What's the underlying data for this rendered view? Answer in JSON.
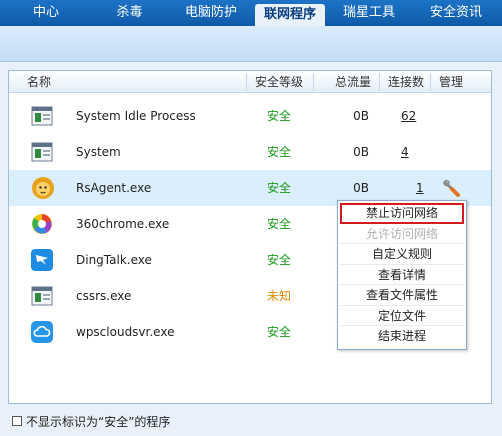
{
  "nav": {
    "tabs": [
      {
        "label": "中心"
      },
      {
        "label": "杀毒"
      },
      {
        "label": "电脑防护"
      },
      {
        "label": "联网程序"
      },
      {
        "label": "瑞星工具"
      },
      {
        "label": "安全资讯"
      }
    ],
    "active_index": 3
  },
  "table": {
    "headers": {
      "name": "名称",
      "level": "安全等级",
      "traffic": "总流量",
      "connections": "连接数",
      "manage": "管理"
    },
    "rows": [
      {
        "name": "System Idle Process",
        "level": "安全",
        "traffic": "0B",
        "connections": "62",
        "icon": "window-icon"
      },
      {
        "name": "System",
        "level": "安全",
        "traffic": "0B",
        "connections": "4",
        "icon": "window-icon"
      },
      {
        "name": "RsAgent.exe",
        "level": "安全",
        "traffic": "0B",
        "connections": "1",
        "icon": "lion-icon"
      },
      {
        "name": "360chrome.exe",
        "level": "安全",
        "icon": "360chrome-icon"
      },
      {
        "name": "DingTalk.exe",
        "level": "安全",
        "icon": "dingtalk-icon"
      },
      {
        "name": "cssrs.exe",
        "level": "未知",
        "icon": "window-icon"
      },
      {
        "name": "wpscloudsvr.exe",
        "level": "安全",
        "icon": "cloud-icon"
      }
    ]
  },
  "context_menu": {
    "items": [
      {
        "label": "禁止访问网络",
        "state": "highlighted"
      },
      {
        "label": "允许访问网络",
        "state": "disabled"
      },
      {
        "label": "自定义规则",
        "state": "normal"
      },
      {
        "label": "查看详情",
        "state": "normal"
      },
      {
        "label": "查看文件属性",
        "state": "normal"
      },
      {
        "label": "定位文件",
        "state": "normal"
      },
      {
        "label": "结束进程",
        "state": "normal"
      }
    ]
  },
  "footer": {
    "checkbox_label": "不显示标识为“安全”的程序",
    "checked": false
  },
  "colors": {
    "nav_bg": "#1565b8",
    "safe": "#1c9a1c",
    "unknown": "#e08a00",
    "highlight_border": "#d51b1b"
  }
}
